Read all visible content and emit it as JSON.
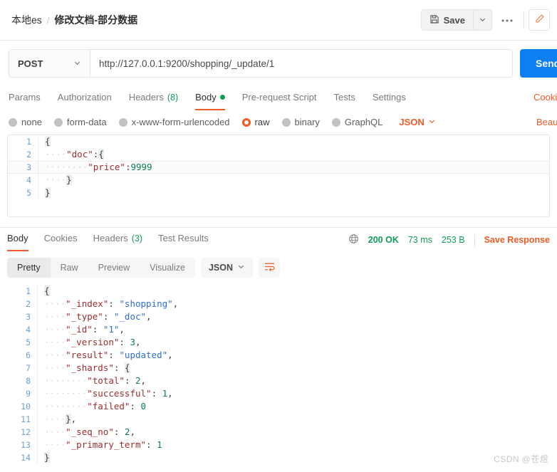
{
  "breadcrumb": {
    "root": "本地es",
    "separator": "/",
    "leaf": "修改文档-部分数据"
  },
  "toolbar": {
    "save_label": "Save",
    "save_icon": "floppy-disk-icon",
    "caret_icon": "chevron-down-icon",
    "more_label": "●●●",
    "edit_icon": "pencil-icon"
  },
  "request": {
    "method": "POST",
    "url": "http://127.0.0.1:9200/shopping/_update/1",
    "send_label": "Send",
    "tabs": [
      {
        "label": "Params",
        "active": false
      },
      {
        "label": "Authorization",
        "active": false
      },
      {
        "label": "Headers",
        "count": "(8)",
        "active": false
      },
      {
        "label": "Body",
        "dot": true,
        "active": true
      },
      {
        "label": "Pre-request Script",
        "active": false
      },
      {
        "label": "Tests",
        "active": false
      },
      {
        "label": "Settings",
        "active": false
      }
    ],
    "tabs_right_label": "Cookies",
    "body_types": [
      {
        "label": "none",
        "selected": false
      },
      {
        "label": "form-data",
        "selected": false
      },
      {
        "label": "x-www-form-urlencoded",
        "selected": false
      },
      {
        "label": "raw",
        "selected": true
      },
      {
        "label": "binary",
        "selected": false
      },
      {
        "label": "GraphQL",
        "selected": false
      }
    ],
    "format": "JSON",
    "beautify_label": "Beautify",
    "body_lines": [
      {
        "n": "1",
        "text": "{"
      },
      {
        "n": "2",
        "text": "    \"doc\":{"
      },
      {
        "n": "3",
        "text": "        \"price\":9999",
        "highlight": true
      },
      {
        "n": "4",
        "text": "    }"
      },
      {
        "n": "5",
        "text": "}"
      }
    ]
  },
  "response": {
    "tabs": [
      {
        "label": "Body",
        "active": true
      },
      {
        "label": "Cookies",
        "active": false
      },
      {
        "label": "Headers",
        "count": "(3)",
        "active": false
      },
      {
        "label": "Test Results",
        "active": false
      }
    ],
    "globe_icon": "globe-icon",
    "status": "200 OK",
    "time": "73 ms",
    "size": "253 B",
    "save_response_label": "Save Response",
    "view_modes": [
      {
        "label": "Pretty",
        "active": true
      },
      {
        "label": "Raw",
        "active": false
      },
      {
        "label": "Preview",
        "active": false
      },
      {
        "label": "Visualize",
        "active": false
      }
    ],
    "format": "JSON",
    "wrap_icon": "word-wrap-icon",
    "body_lines": [
      {
        "n": "1",
        "text": "{"
      },
      {
        "n": "2",
        "text": "    \"_index\": \"shopping\","
      },
      {
        "n": "3",
        "text": "    \"_type\": \"_doc\","
      },
      {
        "n": "4",
        "text": "    \"_id\": \"1\","
      },
      {
        "n": "5",
        "text": "    \"_version\": 3,"
      },
      {
        "n": "6",
        "text": "    \"result\": \"updated\","
      },
      {
        "n": "7",
        "text": "    \"_shards\": {"
      },
      {
        "n": "8",
        "text": "        \"total\": 2,"
      },
      {
        "n": "9",
        "text": "        \"successful\": 1,"
      },
      {
        "n": "10",
        "text": "        \"failed\": 0"
      },
      {
        "n": "11",
        "text": "    },"
      },
      {
        "n": "12",
        "text": "    \"_seq_no\": 2,"
      },
      {
        "n": "13",
        "text": "    \"_primary_term\": 1"
      },
      {
        "n": "14",
        "text": "}"
      }
    ],
    "json_data": {
      "_index": "shopping",
      "_type": "_doc",
      "_id": "1",
      "_version": 3,
      "result": "updated",
      "_shards": {
        "total": 2,
        "successful": 1,
        "failed": 0
      },
      "_seq_no": 2,
      "_primary_term": 1
    }
  },
  "watermark": "CSDN @苍煜",
  "colors": {
    "accent": "#ef5b25",
    "send": "#0c7ff2",
    "success": "#0f9d58"
  }
}
